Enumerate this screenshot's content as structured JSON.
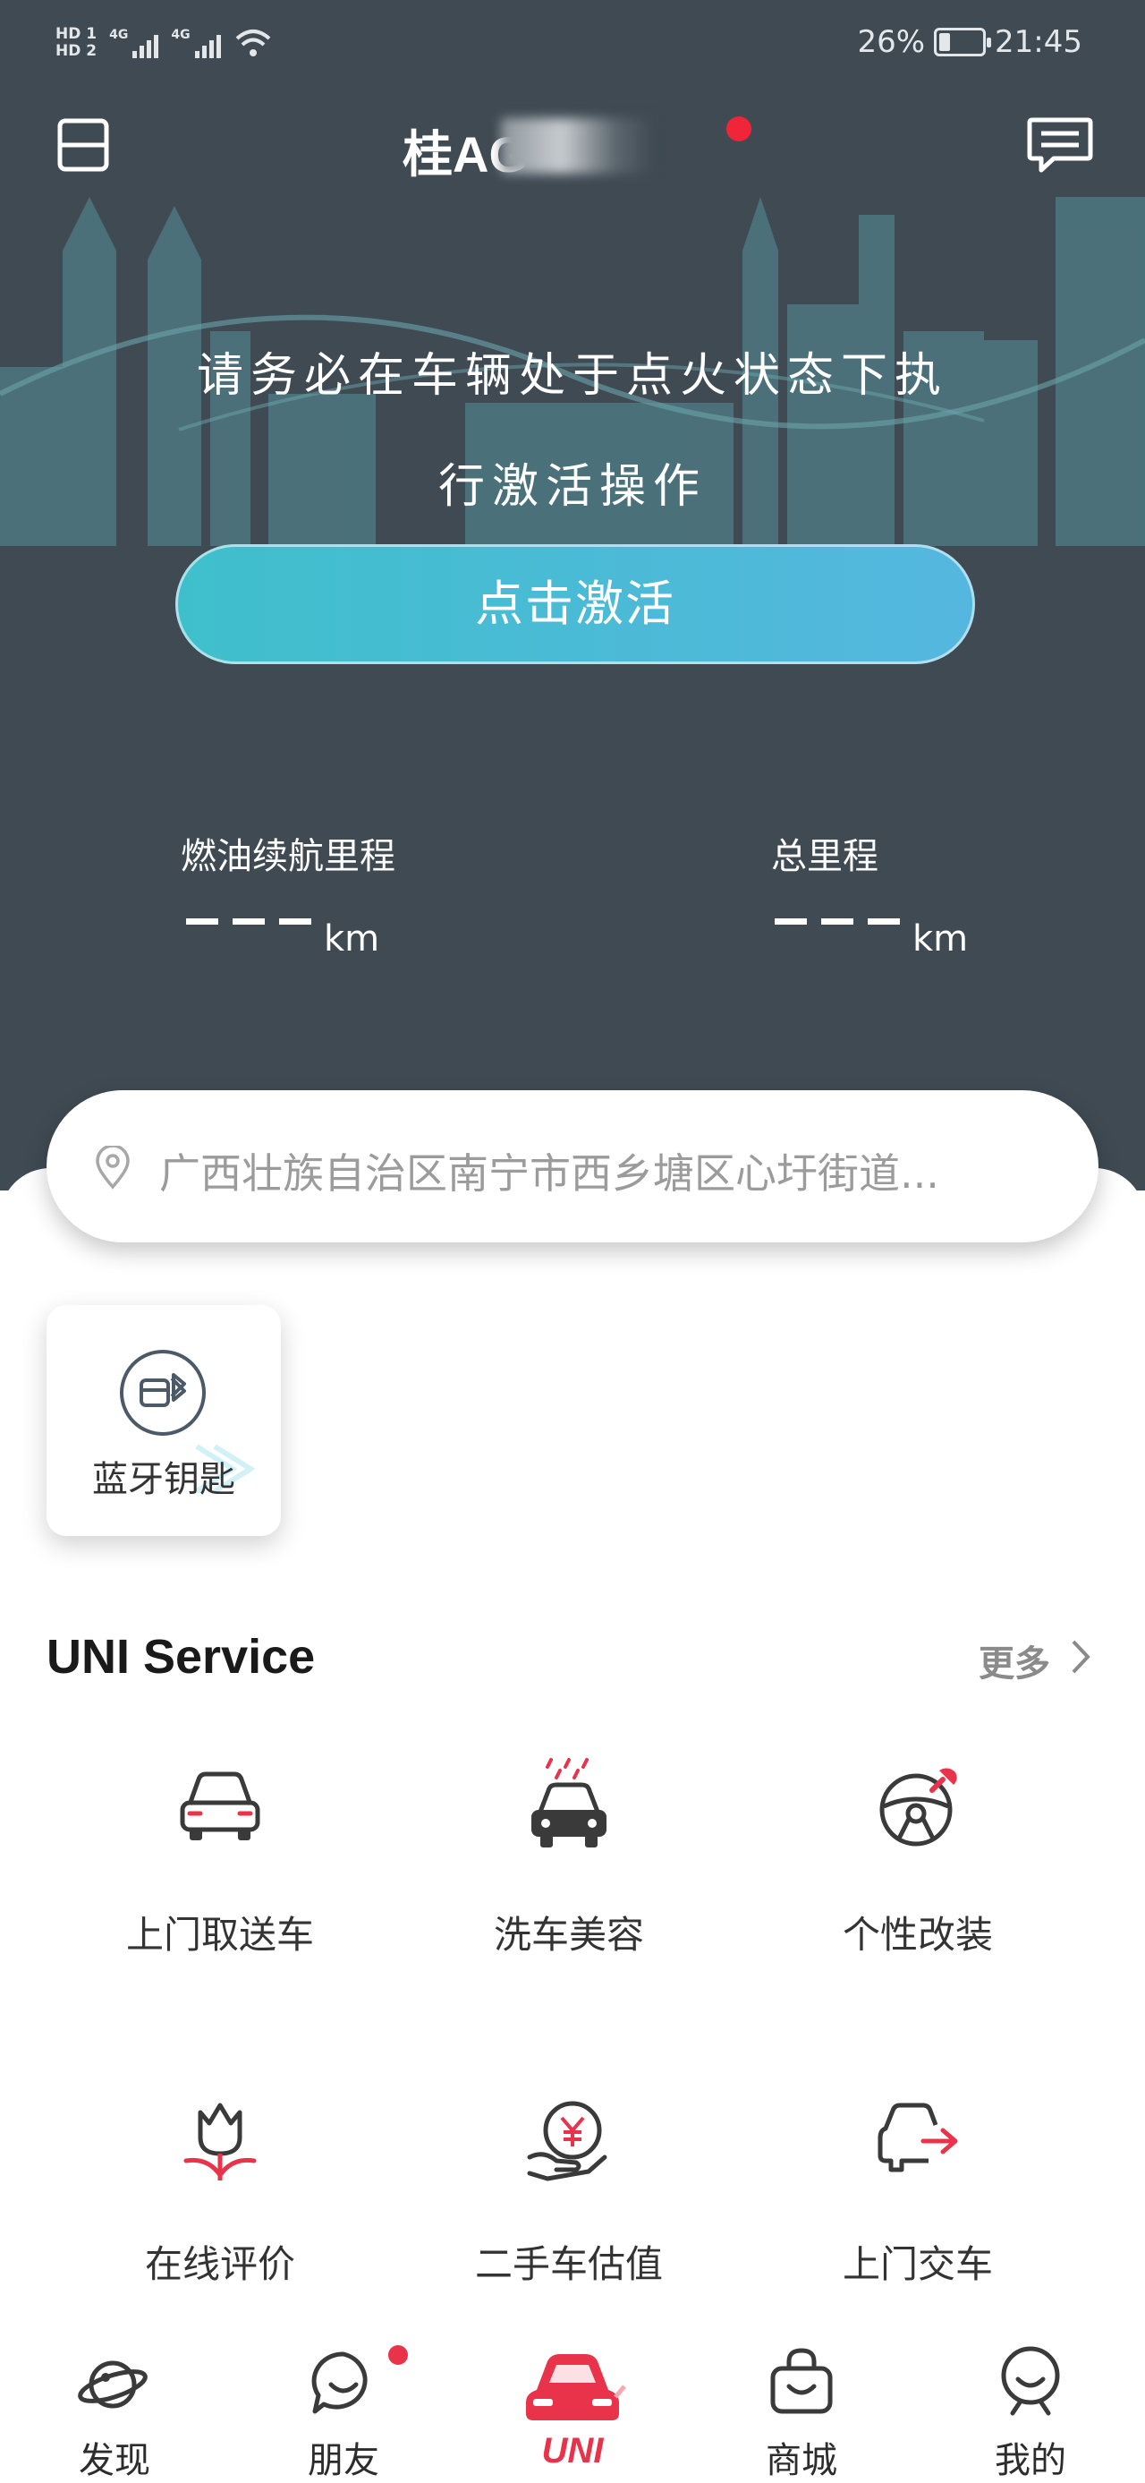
{
  "status_bar": {
    "sim1": "HD 1",
    "sim2": "HD 2",
    "net1": "4G",
    "net2": "4G",
    "battery": "26%",
    "time": "21:45",
    "battery_level": 0.26
  },
  "header": {
    "plate": "桂AG",
    "menu_icon": "layout-icon",
    "message_icon": "message-icon"
  },
  "vehicle": {
    "notice_line1": "请务必在车辆处于点火状态下执",
    "notice_line2": "行激活操作",
    "activate_button": "点击激活",
    "fuel_range_label": "燃油续航里程",
    "fuel_range_unit": "km",
    "total_mileage_label": "总里程",
    "total_mileage_unit": "km"
  },
  "location": {
    "address": "广西壮族自治区南宁市西乡塘区心圩街道..."
  },
  "bluetooth_key": {
    "label": "蓝牙钥匙"
  },
  "service": {
    "title": "UNI Service",
    "more": "更多",
    "items": [
      {
        "label": "上门取送车",
        "icon": "car-front-icon"
      },
      {
        "label": "洗车美容",
        "icon": "car-wash-icon"
      },
      {
        "label": "个性改装",
        "icon": "steering-wheel-icon"
      },
      {
        "label": "在线评价",
        "icon": "tulip-icon"
      },
      {
        "label": "二手车估值",
        "icon": "yuan-hand-icon"
      },
      {
        "label": "上门交车",
        "icon": "car-delivery-icon"
      }
    ]
  },
  "bottom_nav": {
    "items": [
      {
        "label": "发现",
        "icon": "planet-icon"
      },
      {
        "label": "朋友",
        "icon": "chat-bubble-icon"
      },
      {
        "label": "UNI",
        "icon": "uni-car-icon"
      },
      {
        "label": "商城",
        "icon": "shopping-bag-icon"
      },
      {
        "label": "我的",
        "icon": "profile-icon"
      }
    ]
  },
  "colors": {
    "header_bg": "#3f4a53",
    "accent_red": "#e9334a",
    "activate_start": "#3fbfcc",
    "activate_end": "#55b7df"
  }
}
